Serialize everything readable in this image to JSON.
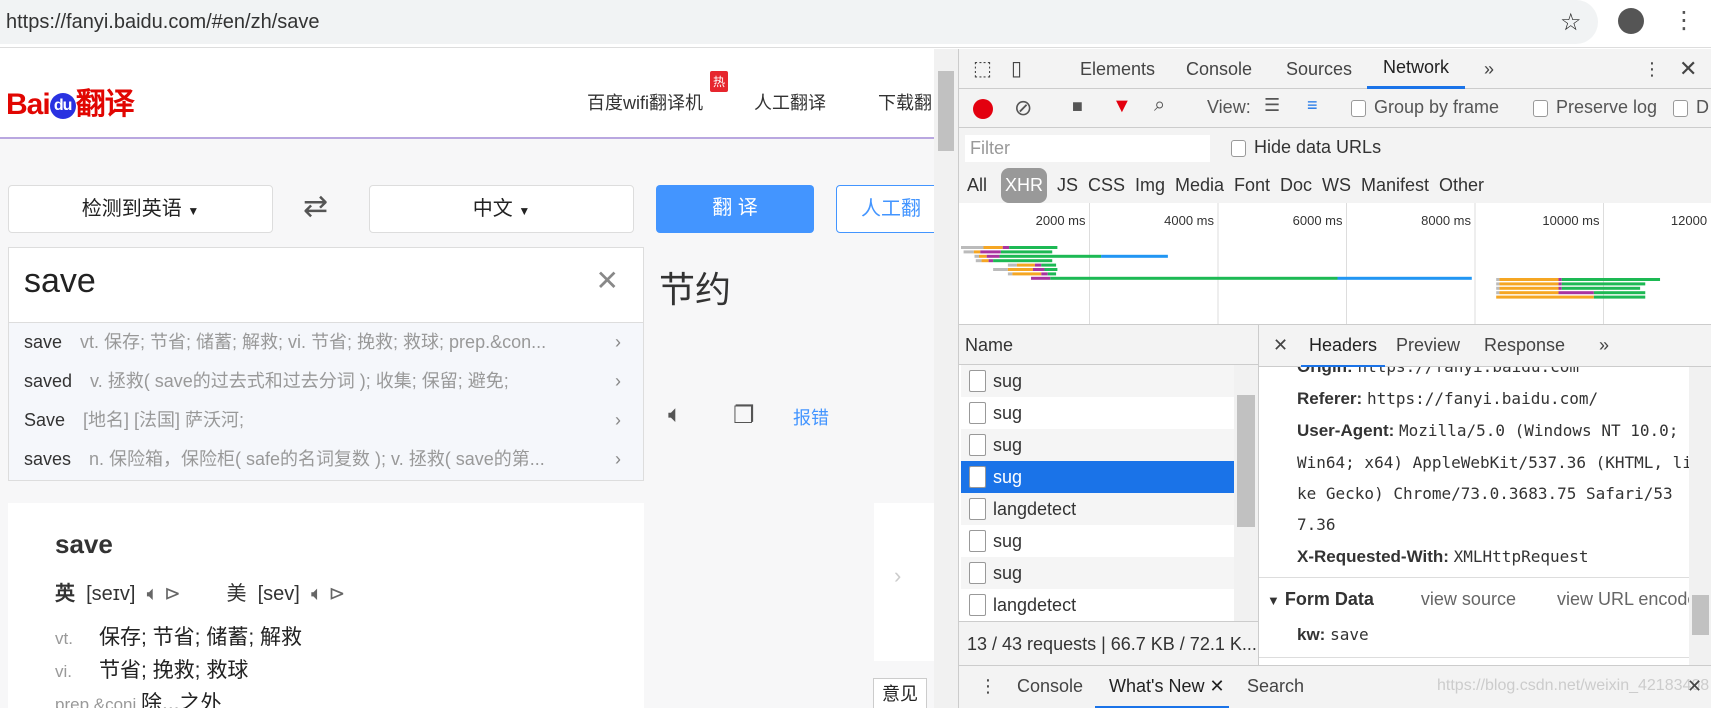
{
  "browser": {
    "url": "https://fanyi.baidu.com/#en/zh/save",
    "icons": [
      "star-icon",
      "account-icon",
      "menu-dots-icon"
    ]
  },
  "page": {
    "logo": {
      "text_bai": "Bai",
      "text_du": "du",
      "text_fanyi": "翻译"
    },
    "nav": [
      {
        "label": "百度wifi翻译机",
        "badge": "热"
      },
      {
        "label": "人工翻译"
      },
      {
        "label": "下载翻"
      }
    ],
    "from_lang": "检测到英语",
    "to_lang": "中文",
    "translate_button": "翻 译",
    "human_button": "人工翻",
    "input_value": "save",
    "suggestions": [
      {
        "word": "save",
        "def": "vt. 保存; 节省; 储蓄; 解救; vi. 节省; 挽救; 救球; prep.&con..."
      },
      {
        "word": "saved",
        "def": "v. 拯救( save的过去式和过去分词 ); 收集; 保留; 避免;"
      },
      {
        "word": "Save",
        "def": "[地名] [法国] 萨沃河;"
      },
      {
        "word": "saves",
        "def": "n. 保险箱，保险柜( safe的名词复数 ); v. 拯救( save的第..."
      }
    ],
    "result": "节约",
    "report_error": "报错",
    "dict": {
      "word": "save",
      "uk_label": "英",
      "uk_phon": "[seɪv]",
      "us_label": "美",
      "us_phon": "[sev]",
      "defs": [
        {
          "pos": "vt.",
          "text": "保存;  节省;  储蓄;  解救"
        },
        {
          "pos": "vi.",
          "text": "节省;  挽救;  救球"
        },
        {
          "pos": "prep.&conj.",
          "text": "除...之外"
        }
      ]
    },
    "feedback": "意见"
  },
  "devtools": {
    "tabs": [
      "Elements",
      "Console",
      "Sources",
      "Network"
    ],
    "active_tab": "Network",
    "toolbar": {
      "view_label": "View:",
      "group_by_frame": "Group by frame",
      "preserve_log": "Preserve log",
      "disable_cache": "D"
    },
    "filter_placeholder": "Filter",
    "hide_data_urls": "Hide data URLs",
    "types": [
      "All",
      "XHR",
      "JS",
      "CSS",
      "Img",
      "Media",
      "Font",
      "Doc",
      "WS",
      "Manifest",
      "Other"
    ],
    "active_type": "XHR",
    "timeline": {
      "ticks": [
        "2000 ms",
        "4000 ms",
        "6000 ms",
        "8000 ms",
        "10000 ms",
        "12000 ms"
      ],
      "rows": [
        [
          0,
          350,
          650,
          750,
          1500
        ],
        [
          40,
          200,
          300,
          620,
          1420
        ],
        [
          210,
          280,
          400,
          600,
          2180,
          3220
        ],
        [
          230,
          320,
          430,
          500,
          1420
        ],
        [
          730,
          870,
          1150,
          1250,
          1480
        ],
        [
          500,
          730,
          1120,
          1300,
          1500
        ],
        [
          730,
          800,
          1250,
          1350,
          1480
        ],
        [
          1090,
          1090,
          1090,
          1390,
          5860,
          7950
        ],
        [
          8330,
          8380,
          9300,
          9350,
          10880
        ],
        [
          8330,
          8380,
          9300,
          9350,
          10650
        ],
        [
          8330,
          8380,
          9300,
          9350,
          10570
        ],
        [
          8330,
          8380,
          9300,
          9850,
          10650
        ],
        [
          8330,
          8330,
          9850,
          9850,
          10650
        ]
      ],
      "colors": {
        "queue": "#bbbbbb",
        "stalled": "#f5a623",
        "ssl": "#a933a0",
        "waiting": "#1db954",
        "download": "#2196f3"
      }
    },
    "name_header": "Name",
    "requests": [
      {
        "name": "sug"
      },
      {
        "name": "sug"
      },
      {
        "name": "sug"
      },
      {
        "name": "sug",
        "selected": true
      },
      {
        "name": "langdetect"
      },
      {
        "name": "sug"
      },
      {
        "name": "sug"
      },
      {
        "name": "langdetect"
      }
    ],
    "status": "13 / 43 requests  |  66.7 KB / 72.1 K...",
    "detail_tabs": [
      "Headers",
      "Preview",
      "Response"
    ],
    "active_detail_tab": "Headers",
    "headers": [
      {
        "k": "Origin:",
        "v": "https://fanyi.baidu.com"
      },
      {
        "k": "Referer:",
        "v": "https://fanyi.baidu.com/"
      },
      {
        "k": "User-Agent:",
        "v": "Mozilla/5.0 (Windows NT 10.0;"
      },
      {
        "k": "",
        "v": "Win64; x64) AppleWebKit/537.36 (KHTML, li"
      },
      {
        "k": "",
        "v": "ke Gecko) Chrome/73.0.3683.75 Safari/53"
      },
      {
        "k": "",
        "v": "7.36"
      },
      {
        "k": "X-Requested-With:",
        "v": "XMLHttpRequest"
      }
    ],
    "form_data": {
      "title": "Form Data",
      "view_source": "view source",
      "view_url": "view URL encoded",
      "kw_key": "kw:",
      "kw_value": "save"
    },
    "drawer": {
      "tabs": [
        "Console",
        "What's New",
        "Search"
      ],
      "active": "What's New"
    },
    "watermark": "https://blog.csdn.net/weixin_42183408"
  }
}
